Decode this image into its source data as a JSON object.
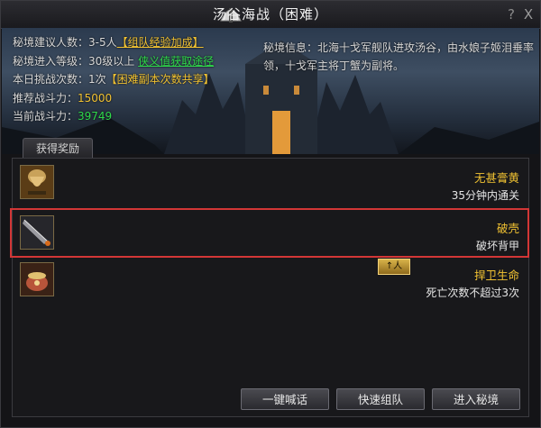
{
  "window": {
    "title": "汤谷海战（困难）",
    "help_glyph": "?",
    "close_glyph": "X"
  },
  "info": {
    "players_label": "秘境建议人数：",
    "players_value": "3-5人",
    "players_link": "【组队经验加成】",
    "level_label": "秘境进入等级：",
    "level_value": "30级以上",
    "level_link": "侠义值获取途径",
    "challenges_label": "本日挑战次数：",
    "challenges_value": "1次",
    "challenges_link": "【困难副本次数共享】",
    "recommended_power_label": "推荐战斗力：",
    "recommended_power_value": "15000",
    "current_power_label": "当前战斗力：",
    "current_power_value": "39749",
    "description": "秘境信息：北海十戈军舰队进攻汤谷，由水娘子姬泪垂率领，十戈军主将丁蟹为副将。"
  },
  "rewards": {
    "tab_label": "获得奖励",
    "up_badge": "↑人",
    "items": [
      {
        "icon": "hourglass-scroll-icon",
        "name": "无甚膏黄",
        "desc": "35分钟内通关"
      },
      {
        "icon": "broken-blade-icon",
        "name": "破壳",
        "desc": "破坏背甲"
      },
      {
        "icon": "cauldron-icon",
        "name": "捍卫生命",
        "desc": "死亡次数不超过3次"
      }
    ]
  },
  "buttons": {
    "shout": "一键喊话",
    "quick_team": "快速组队",
    "enter": "进入秘境"
  },
  "colors": {
    "highlight_border": "#d23636",
    "gold_text": "#f1c232",
    "green_text": "#2fd94b"
  }
}
